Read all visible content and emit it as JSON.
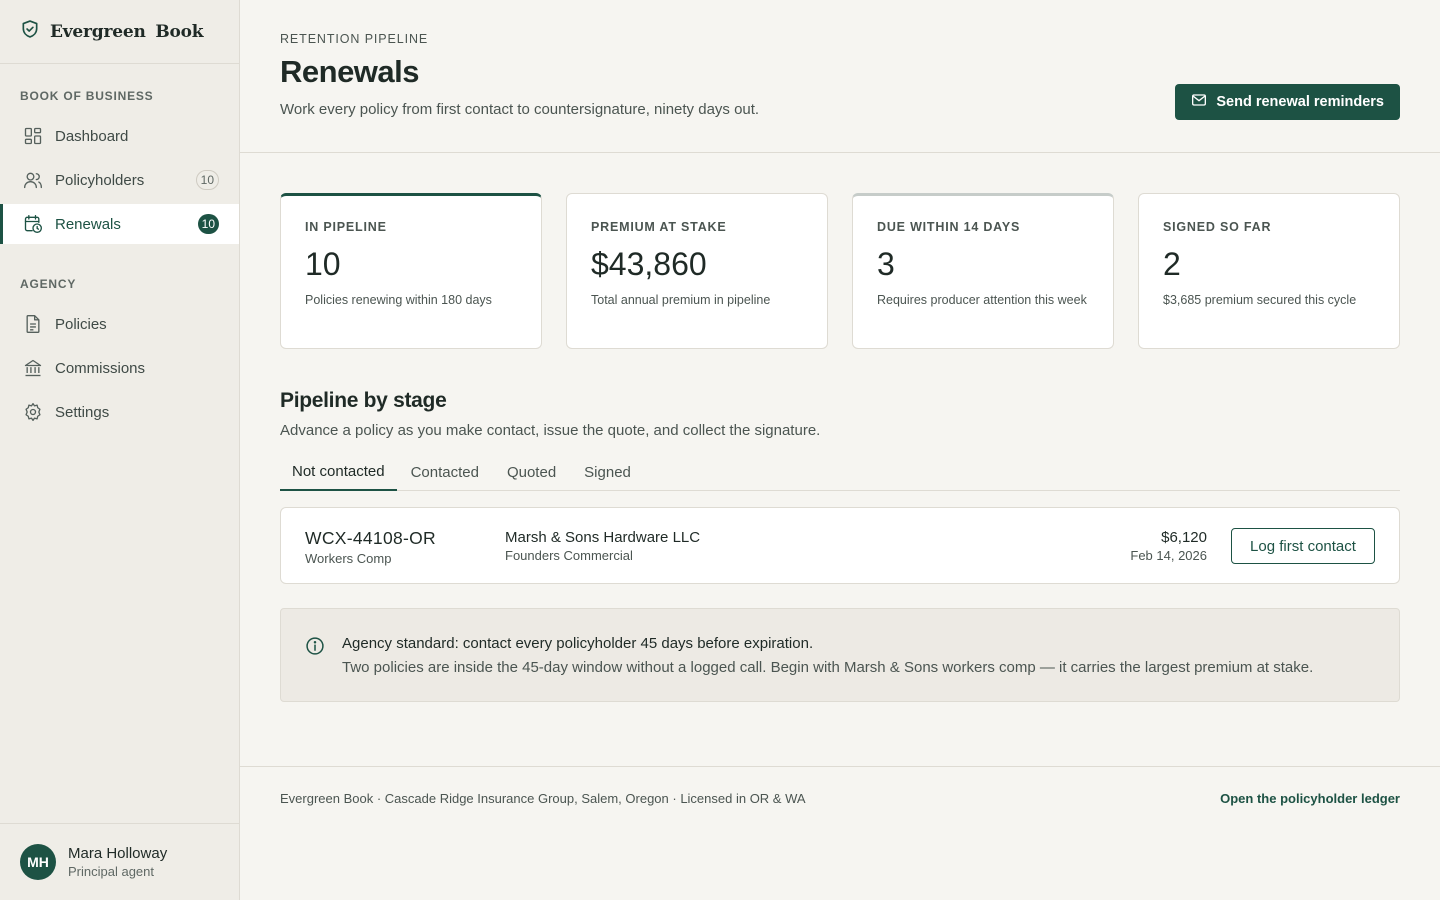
{
  "app": {
    "brand": "Evergreen Book"
  },
  "sidebar": {
    "sections": [
      {
        "label": "BOOK OF BUSINESS"
      },
      {
        "label": "AGENCY"
      }
    ],
    "items": [
      {
        "label": "Dashboard",
        "icon": "dashboard-icon"
      },
      {
        "label": "Policyholders",
        "icon": "users-icon",
        "badge": "10"
      },
      {
        "label": "Renewals",
        "icon": "calendar-clock-icon",
        "badge": "10",
        "active": true
      },
      {
        "label": "Policies",
        "icon": "document-icon"
      },
      {
        "label": "Commissions",
        "icon": "bank-icon"
      },
      {
        "label": "Settings",
        "icon": "gear-icon"
      }
    ],
    "user": {
      "initials": "MH",
      "name": "Mara Holloway",
      "role": "Principal agent"
    }
  },
  "header": {
    "eyebrow": "RETENTION PIPELINE",
    "title": "Renewals",
    "subtitle": "Work every policy from first contact to countersignature, ninety days out.",
    "primary_action": "Send renewal reminders"
  },
  "stats": [
    {
      "label": "IN PIPELINE",
      "value": "10",
      "note": "Policies renewing within 180 days"
    },
    {
      "label": "PREMIUM AT STAKE",
      "value": "$43,860",
      "note": "Total annual premium in pipeline"
    },
    {
      "label": "DUE WITHIN 14 DAYS",
      "value": "3",
      "note": "Requires producer attention this week"
    },
    {
      "label": "SIGNED SO FAR",
      "value": "2",
      "note": "$3,685 premium secured this cycle"
    }
  ],
  "pipeline": {
    "title": "Pipeline by stage",
    "subtitle": "Advance a policy as you make contact, issue the quote, and collect the signature.",
    "tabs": [
      "Not contacted",
      "Contacted",
      "Quoted",
      "Signed"
    ],
    "active_tab": "Not contacted",
    "rows": [
      {
        "policy_id": "WCX-44108-OR",
        "line": "Workers Comp",
        "holder": "Marsh & Sons Hardware LLC",
        "carrier": "Founders Commercial",
        "premium": "$6,120",
        "expires": "Feb 14, 2026",
        "action": "Log first contact"
      }
    ]
  },
  "callout": {
    "title": "Agency standard: contact every policyholder 45 days before expiration.",
    "body": "Two policies are inside the 45-day window without a logged call. Begin with Marsh & Sons workers comp — it carries the largest premium at stake."
  },
  "footer": {
    "text": "Evergreen Book · Cascade Ridge Insurance Group, Salem, Oregon · Licensed in OR & WA",
    "link": "Open the policyholder ledger"
  },
  "colors": {
    "accent": "#1d5244",
    "background": "#f6f5f1",
    "sidebar": "#efede7"
  }
}
